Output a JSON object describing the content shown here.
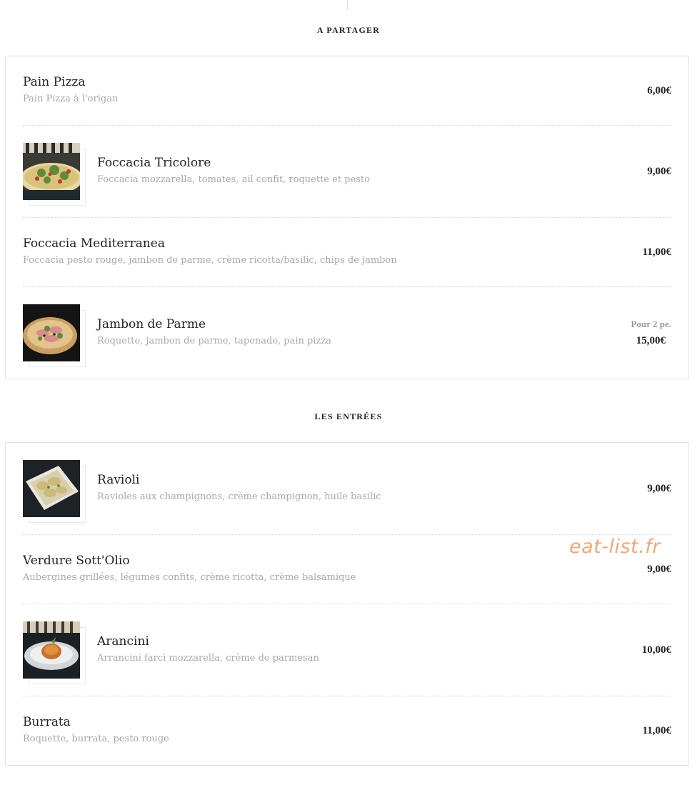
{
  "sections": [
    {
      "title": "A PARTAGER",
      "items": [
        {
          "name": "Pain Pizza",
          "description": "Pain Pizza à l'origan",
          "price": "6,00€"
        },
        {
          "name": "Foccacia Tricolore",
          "description": "Foccacia mozzarella, tomates, ail confit, roquette et pesto",
          "price": "9,00€",
          "image": "foccacia-photo"
        },
        {
          "name": "Foccacia Mediterranea",
          "description": "Foccacia pesto rouge, jambon de parme, crème ricotta/basilic, chips de jambon",
          "price": "11,00€"
        },
        {
          "name": "Jambon de Parme",
          "description": "Roquette, jambon de parme, tapenade, pain pizza",
          "price_note": "Pour 2 pe.",
          "price": "15,00€",
          "image": "jambon-photo"
        }
      ]
    },
    {
      "title": "LES ENTRÉES",
      "items": [
        {
          "name": "Ravioli",
          "description": "Ravioles aux champignons, crème champignon, huile basilic",
          "price": "9,00€",
          "image": "ravioli-photo"
        },
        {
          "name": "Verdure Sott'Olio",
          "description": "Aubergines grillées, légumes confits, crème ricotta, crème balsamique",
          "price": "9,00€"
        },
        {
          "name": "Arancini",
          "description": "Arrancini farci mozzarella, crème de parmesan",
          "price": "10,00€",
          "image": "arancini-photo"
        },
        {
          "name": "Burrata",
          "description": "Roquette, burrata, pesto rouge",
          "price": "11,00€"
        }
      ]
    }
  ],
  "watermark": "eat-list.fr",
  "colors": {
    "watermark": "#f0a878",
    "description": "#a8a8a8",
    "border": "#e4e4e4"
  }
}
